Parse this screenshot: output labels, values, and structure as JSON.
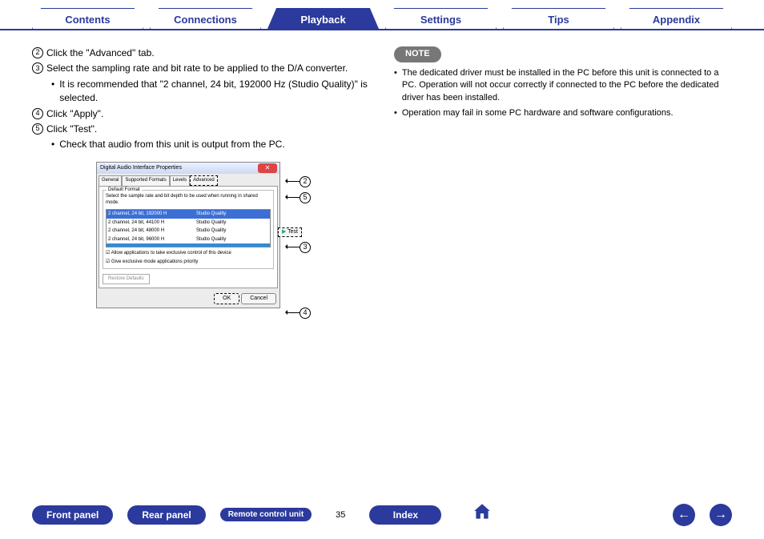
{
  "tabs": {
    "items": [
      {
        "label": "Contents",
        "active": false
      },
      {
        "label": "Connections",
        "active": false
      },
      {
        "label": "Playback",
        "active": true
      },
      {
        "label": "Settings",
        "active": false
      },
      {
        "label": "Tips",
        "active": false
      },
      {
        "label": "Appendix",
        "active": false
      }
    ]
  },
  "left": {
    "step2": "Click the \"Advanced\" tab.",
    "step3": "Select the sampling rate and bit rate to be applied to the D/A converter.",
    "bullet3": "It is recommended that \"2 channel, 24 bit, 192000 Hz (Studio Quality)\" is selected.",
    "step4": "Click \"Apply\".",
    "step5": "Click \"Test\".",
    "bullet5": "Check that audio from this unit is output from the PC."
  },
  "dialog": {
    "title": "Digital Audio Interface Properties",
    "tabs": {
      "general": "General",
      "supported": "Supported Formats",
      "levels": "Levels",
      "advanced": "Advanced"
    },
    "group_label": "Default Format",
    "instruction": "Select the sample rate and bit depth to be used when running in shared mode.",
    "formats": [
      {
        "c1": "2 channel, 24 bit, 192000 H",
        "c2": "Studio Quality",
        "selected": true
      },
      {
        "c1": "2 channel, 24 bit, 44100 H",
        "c2": "Studio Quality",
        "selected": false
      },
      {
        "c1": "2 channel, 24 bit, 48000 H",
        "c2": "Studio Quality",
        "selected": false
      },
      {
        "c1": "2 channel, 24 bit, 96000 H",
        "c2": "Studio Quality",
        "selected": false
      }
    ],
    "test_label": "Test",
    "chk1": "Allow applications to take exclusive control of this device",
    "chk2": "Give exclusive mode applications priority",
    "restore": "Restore Defaults",
    "ok": "OK",
    "cancel": "Cancel"
  },
  "callouts": {
    "n2": "2",
    "n3": "3",
    "n4": "4",
    "n5": "5"
  },
  "right": {
    "note_label": "NOTE",
    "note1": "The dedicated driver must be installed in the PC before this unit is connected to a PC. Operation will not occur correctly if connected to the PC before the dedicated driver has been installed.",
    "note2": "Operation may fail in some PC hardware and software configurations."
  },
  "bottom": {
    "front": "Front panel",
    "rear": "Rear panel",
    "remote": "Remote control unit",
    "page": "35",
    "index": "Index"
  }
}
